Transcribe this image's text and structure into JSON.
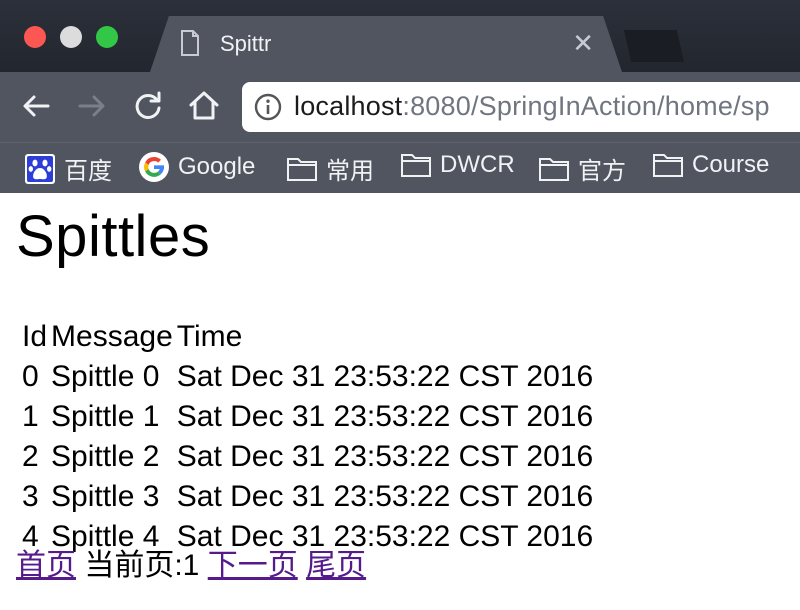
{
  "browser": {
    "tab_title": "Spittr",
    "url_host": "localhost",
    "url_path": ":8080/SpringInAction/home/sp",
    "bookmarks": [
      {
        "label": "百度",
        "icon": "baidu-icon"
      },
      {
        "label": "Google",
        "icon": "google-icon"
      },
      {
        "label": "常用",
        "icon": "folder-icon"
      },
      {
        "label": "DWCR",
        "icon": "folder-icon"
      },
      {
        "label": "官方",
        "icon": "folder-icon"
      },
      {
        "label": "Course",
        "icon": "folder-icon"
      }
    ],
    "colors": {
      "close": "#fc5753",
      "minimize": "#dcdcdc",
      "maximize": "#33c748",
      "chrome": "#505560"
    }
  },
  "page": {
    "heading": "Spittles",
    "table": {
      "headers": [
        "Id",
        "Message",
        "Time"
      ],
      "rows": [
        [
          "0",
          "Spittle 0",
          "Sat Dec 31 23:53:22 CST 2016"
        ],
        [
          "1",
          "Spittle 1",
          "Sat Dec 31 23:53:22 CST 2016"
        ],
        [
          "2",
          "Spittle 2",
          "Sat Dec 31 23:53:22 CST 2016"
        ],
        [
          "3",
          "Spittle 3",
          "Sat Dec 31 23:53:22 CST 2016"
        ],
        [
          "4",
          "Spittle 4",
          "Sat Dec 31 23:53:22 CST 2016"
        ]
      ]
    },
    "pager": {
      "first": "首页",
      "current": "当前页:1",
      "next": "下一页",
      "last": "尾页"
    }
  }
}
